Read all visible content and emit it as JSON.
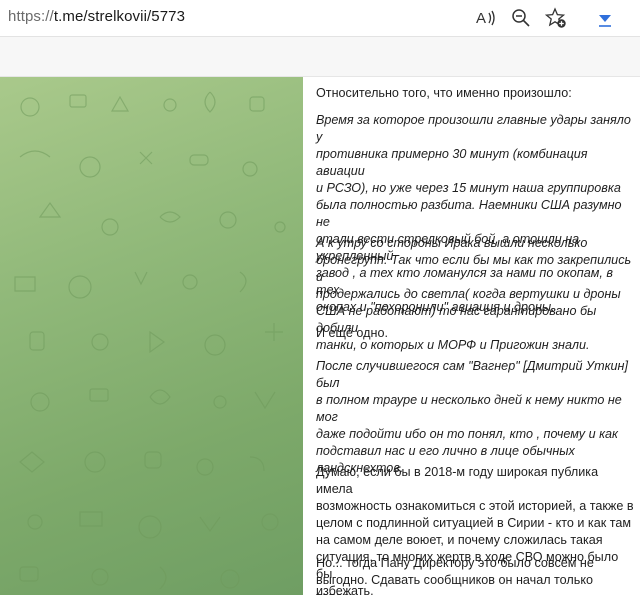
{
  "browser": {
    "url_prefix": "https://",
    "url_rest": "t.me/strelkovii/5773"
  },
  "post": {
    "paragraphs": [
      {
        "lines": [
          "Относительно того, что именно произошло:"
        ],
        "italic": false
      },
      {
        "lines": [
          "Время за которое произошли главные удары заняло у",
          "противника примерно 30 минут (комбинация авиации",
          "и РСЗО), но уже через 15 минут наша группировка",
          "была полностью разбита. Наемники США разумно не",
          "стали вести стрелковый бой, а отошли на укрепленный",
          "завод , а тех кто ломанулся за нами по окопам, в тех",
          "окопах и \"похоронили\" авиация и дроны."
        ],
        "italic": true
      },
      {
        "lines": [
          "А к утру со стороны Ирака вышли несколько",
          "бронегрупп. Так что если бы мы как то закрепились и",
          "продержались до светла( когда вертушки и дроны",
          "США не работают) то нас гарантировано бы добили",
          "танки, о которых и МОРФ и Пригожин знали."
        ],
        "italic": true
      },
      {
        "lines": [
          "И ещё одно."
        ],
        "italic": false
      },
      {
        "lines": [
          "После случившегося сам \"Вагнер\" [Дмитрий Уткин] был",
          "в полном трауре и несколько дней к нему никто не мог",
          "даже подойти ибо он то понял, кто , почему и как",
          "подставил нас и его лично в лице обычных",
          "ландскнехтов."
        ],
        "italic": true
      },
      {
        "lines": [
          "Думаю, если бы в 2018-м году широкая публика имела",
          "возможность ознакомиться с этой историей, а также в",
          "целом с подлинной ситуацией в Сирии - кто и как там",
          "на самом деле воюет, и почему сложилась такая",
          "ситуация, то многих жертв в ходе СВО можно было бы",
          "избежать."
        ],
        "italic": false
      },
      {
        "lines": [
          "Но... тогда Пану Директору это было совсем не",
          "выгодно. Сдавать сообщников он начал только теперь."
        ],
        "italic": false
      }
    ]
  },
  "icons": [
    "read-aloud-icon",
    "zoom-out-icon",
    "favorite-add-icon",
    "download-arrow-icon"
  ],
  "colors": {
    "background_green": "#91b97a",
    "download_accent": "#2f6fdb",
    "text": "#1f1f1f"
  }
}
